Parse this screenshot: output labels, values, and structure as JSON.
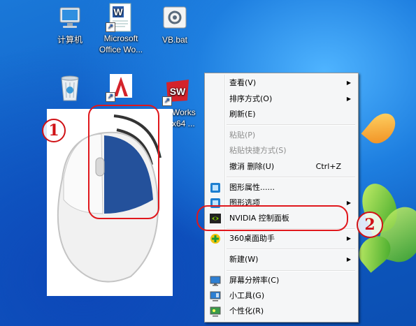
{
  "desktop": {
    "icons": [
      {
        "label": "计算机",
        "icon": "computer-icon"
      },
      {
        "label": "Microsoft Office Wo...",
        "icon": "word-icon"
      },
      {
        "label": "VB.bat",
        "icon": "bat-file-icon"
      },
      {
        "label": "",
        "icon": "recycle-bin-icon"
      },
      {
        "label": "",
        "icon": "autocad-icon"
      },
      {
        "label": "Works x64 ...",
        "icon": "solidworks-icon"
      }
    ]
  },
  "annotations": {
    "step1": "1",
    "step2": "2"
  },
  "context_menu": {
    "items": [
      {
        "label": "查看(V)",
        "submenu": true,
        "disabled": false
      },
      {
        "label": "排序方式(O)",
        "submenu": true,
        "disabled": false
      },
      {
        "label": "刷新(E)",
        "submenu": false,
        "disabled": false
      },
      {
        "label": "粘贴(P)",
        "submenu": false,
        "disabled": true
      },
      {
        "label": "粘贴快捷方式(S)",
        "submenu": false,
        "disabled": true
      },
      {
        "label": "撤消 删除(U)",
        "shortcut": "Ctrl+Z",
        "submenu": false,
        "disabled": false
      },
      {
        "label": "图形属性......",
        "icon": "intel-graphics-icon",
        "submenu": false,
        "disabled": false
      },
      {
        "label": "图形选项",
        "icon": "intel-graphics-icon",
        "submenu": true,
        "disabled": false
      },
      {
        "label": "NVIDIA 控制面板",
        "icon": "nvidia-icon",
        "submenu": false,
        "disabled": false,
        "highlighted": true
      },
      {
        "label": "360桌面助手",
        "icon": "360-icon",
        "submenu": true,
        "disabled": false
      },
      {
        "label": "新建(W)",
        "submenu": true,
        "disabled": false
      },
      {
        "label": "屏幕分辨率(C)",
        "icon": "display-icon",
        "submenu": false,
        "disabled": false
      },
      {
        "label": "小工具(G)",
        "icon": "gadgets-icon",
        "submenu": false,
        "disabled": false
      },
      {
        "label": "个性化(R)",
        "icon": "personalize-icon",
        "submenu": false,
        "disabled": false
      }
    ]
  },
  "colors": {
    "highlight": "#e0171c",
    "mouse_button": "#24519b"
  }
}
